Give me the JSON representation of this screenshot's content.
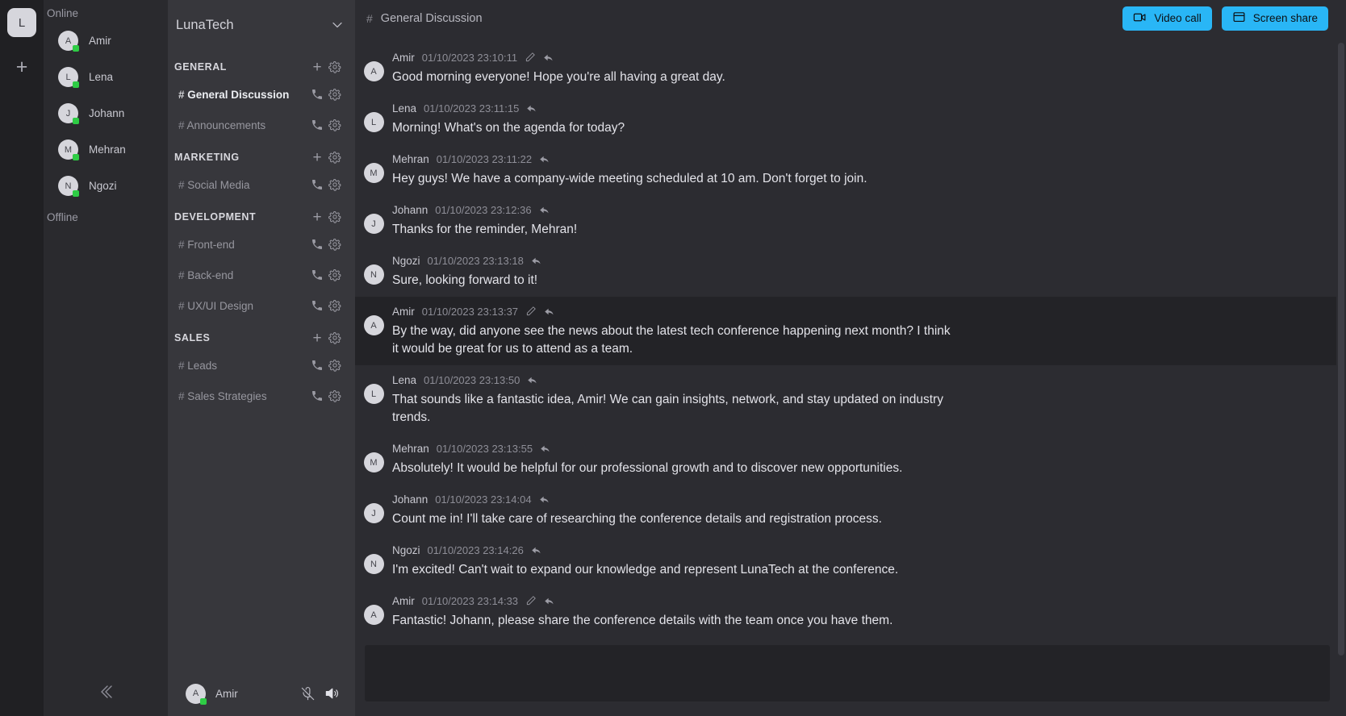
{
  "rail": {
    "logo_letter": "L",
    "add_label": "+",
    "add_icon": "plus-icon"
  },
  "members": {
    "online_label": "Online",
    "offline_label": "Offline",
    "online": [
      {
        "initial": "A",
        "name": "Amir"
      },
      {
        "initial": "L",
        "name": "Lena"
      },
      {
        "initial": "J",
        "name": "Johann"
      },
      {
        "initial": "M",
        "name": "Mehran"
      },
      {
        "initial": "N",
        "name": "Ngozi"
      }
    ],
    "offline": [],
    "collapse_icon": "chevron-double-left-icon"
  },
  "server": {
    "name": "LunaTech",
    "chevron_icon": "chevron-down-icon",
    "categories": [
      {
        "label": "GENERAL",
        "channels": [
          {
            "hash": "#",
            "name": "General Discussion",
            "active": true
          },
          {
            "hash": "#",
            "name": "Announcements",
            "active": false
          }
        ]
      },
      {
        "label": "MARKETING",
        "channels": [
          {
            "hash": "#",
            "name": "Social Media",
            "active": false
          }
        ]
      },
      {
        "label": "DEVELOPMENT",
        "channels": [
          {
            "hash": "#",
            "name": "Front-end",
            "active": false
          },
          {
            "hash": "#",
            "name": "Back-end",
            "active": false
          },
          {
            "hash": "#",
            "name": "UX/UI Design",
            "active": false
          }
        ]
      },
      {
        "label": "SALES",
        "channels": [
          {
            "hash": "#",
            "name": "Leads",
            "active": false
          },
          {
            "hash": "#",
            "name": "Sales Strategies",
            "active": false
          }
        ]
      }
    ],
    "add_channel_icon": "plus-icon",
    "category_settings_icon": "gear-icon",
    "channel_call_icon": "phone-icon",
    "channel_settings_icon": "gear-icon"
  },
  "current_user": {
    "initial": "A",
    "name": "Amir",
    "mic_icon": "microphone-muted-icon",
    "speaker_icon": "speaker-on-icon"
  },
  "header": {
    "hash": "#",
    "channel_title": "General Discussion",
    "video_call_label": "Video call",
    "video_call_icon": "video-camera-icon",
    "screen_share_label": "Screen share",
    "screen_share_icon": "screen-share-icon",
    "accent_color": "#29b6f6"
  },
  "composer": {
    "placeholder": ""
  },
  "messages": [
    {
      "initial": "A",
      "author": "Amir",
      "time": "01/10/2023 23:10:11",
      "text": "Good morning everyone! Hope you're all having a great day.",
      "editable": true,
      "selected": false
    },
    {
      "initial": "L",
      "author": "Lena",
      "time": "01/10/2023 23:11:15",
      "text": "Morning! What's on the agenda for today?",
      "editable": false,
      "selected": false
    },
    {
      "initial": "M",
      "author": "Mehran",
      "time": "01/10/2023 23:11:22",
      "text": "Hey guys! We have a company-wide meeting scheduled at 10 am. Don't forget to join.",
      "editable": false,
      "selected": false
    },
    {
      "initial": "J",
      "author": "Johann",
      "time": "01/10/2023 23:12:36",
      "text": "Thanks for the reminder, Mehran!",
      "editable": false,
      "selected": false
    },
    {
      "initial": "N",
      "author": "Ngozi",
      "time": "01/10/2023 23:13:18",
      "text": "Sure, looking forward to it!",
      "editable": false,
      "selected": false
    },
    {
      "initial": "A",
      "author": "Amir",
      "time": "01/10/2023 23:13:37",
      "text": "By the way, did anyone see the news about the latest tech conference happening next month? I think it would be great for us to attend as a team.",
      "editable": true,
      "selected": true
    },
    {
      "initial": "L",
      "author": "Lena",
      "time": "01/10/2023 23:13:50",
      "text": "That sounds like a fantastic idea, Amir! We can gain insights, network, and stay updated on industry trends.",
      "editable": false,
      "selected": false
    },
    {
      "initial": "M",
      "author": "Mehran",
      "time": "01/10/2023 23:13:55",
      "text": "Absolutely! It would be helpful for our professional growth and to discover new opportunities.",
      "editable": false,
      "selected": false
    },
    {
      "initial": "J",
      "author": "Johann",
      "time": "01/10/2023 23:14:04",
      "text": "Count me in! I'll take care of researching the conference details and registration process.",
      "editable": false,
      "selected": false
    },
    {
      "initial": "N",
      "author": "Ngozi",
      "time": "01/10/2023 23:14:26",
      "text": "I'm excited! Can't wait to expand our knowledge and represent LunaTech at the conference.",
      "editable": false,
      "selected": false
    },
    {
      "initial": "A",
      "author": "Amir",
      "time": "01/10/2023 23:14:33",
      "text": "Fantastic! Johann, please share the conference details with the team once you have them.",
      "editable": true,
      "selected": false
    }
  ],
  "icons": {
    "edit": "pencil-icon",
    "reply": "reply-arrow-icon"
  }
}
